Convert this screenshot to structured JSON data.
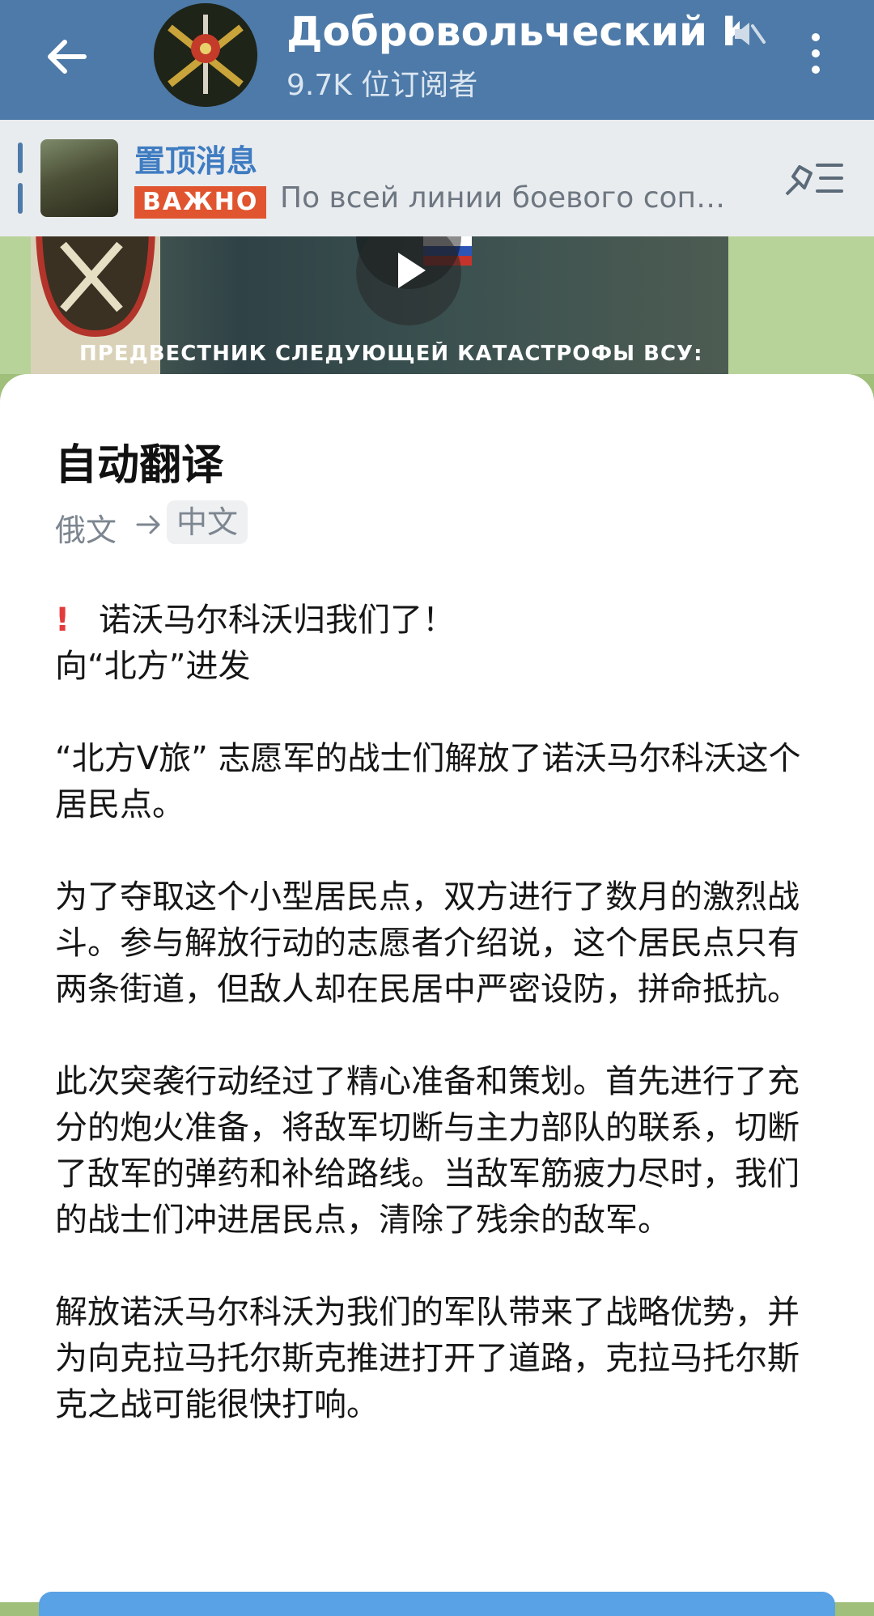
{
  "header": {
    "channel_title": "Добровольческий Ко",
    "subscribers": "9.7K 位订阅者",
    "icons": [
      "back-arrow-icon",
      "channel-avatar",
      "muted-icon",
      "more-vertical-icon"
    ]
  },
  "pinned": {
    "title": "置顶消息",
    "badge": "ВАЖНО",
    "preview": "По всей линии боевого соп…"
  },
  "video": {
    "caption": "ПРЕДВЕСТНИК СЛЕДУЮЩЕЙ КАТАСТРОФЫ ВСУ:"
  },
  "sheet": {
    "title": "自动翻译",
    "lang_from": "俄文",
    "lang_to": "中文",
    "paragraphs": [
      "诺沃马尔科沃归我们了！",
      "向“北方”进发",
      "“北方V旅” 志愿军的战士们解放了诺沃马尔科沃这个居民点。",
      "为了夺取这个小型居民点，双方进行了数月的激烈战斗。参与解放行动的志愿者介绍说，这个居民点只有两条街道，但敌人却在民居中严密设防，拼命抵抗。",
      "此次突袭行动经过了精心准备和策划。首先进行了充分的炮火准备，将敌军切断与主力部队的联系，切断了敌军的弹药和补给路线。当敌军筋疲力尽时，我们的战士们冲进居民点，清除了残余的敌军。",
      "解放诺沃马尔科沃为我们的军队带来了战略优势，并为向克拉马托尔斯克推进打开了道路，克拉马托尔斯克之战可能很快打响。"
    ]
  },
  "colors": {
    "header_bg": "#4d7aa8",
    "link_blue": "#3f7cc1",
    "badge_red": "#e0552f",
    "exclamation": "#e23b3b"
  }
}
